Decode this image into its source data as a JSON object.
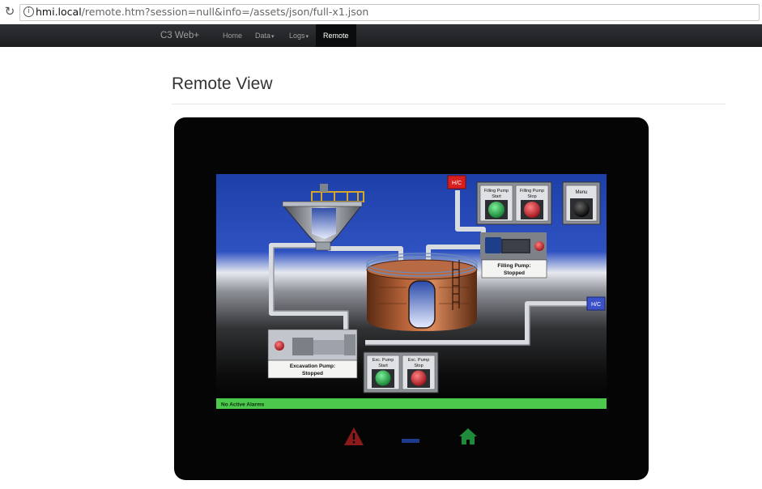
{
  "browser": {
    "url_host": "hmi.local",
    "url_path": "/remote.htm?session=null&info=/assets/json/full-x1.json"
  },
  "navbar": {
    "brand": "C3 Web+",
    "items": [
      {
        "label": "Home"
      },
      {
        "label": "Data"
      },
      {
        "label": "Logs"
      },
      {
        "label": "Remote"
      }
    ]
  },
  "page": {
    "title": "Remote View"
  },
  "hmi": {
    "hc_top": "H/C",
    "hc_right": "H/C",
    "filling_start": [
      "Filling Pump",
      "Start"
    ],
    "filling_stop": [
      "Filling Pump",
      "Stop"
    ],
    "menu": "Menu",
    "filling_status": [
      "Filling Pump:",
      "Stopped"
    ],
    "excavation_status": [
      "Excavation Pump:",
      "Stopped"
    ],
    "exc_start": [
      "Exc. Pump",
      "Start"
    ],
    "exc_stop": [
      "Exc. Pump",
      "Stop"
    ],
    "alarm_bar": "No Active Alarms"
  },
  "colors": {
    "alarm_green": "#4cc94c",
    "start_green": "#27a844",
    "stop_red": "#d8202a",
    "alarm_icon_red": "#8b1a1a",
    "home_icon_green": "#1f8a3a"
  },
  "device_buttons": [
    "alarm-icon",
    "minimize-icon",
    "home-icon"
  ]
}
